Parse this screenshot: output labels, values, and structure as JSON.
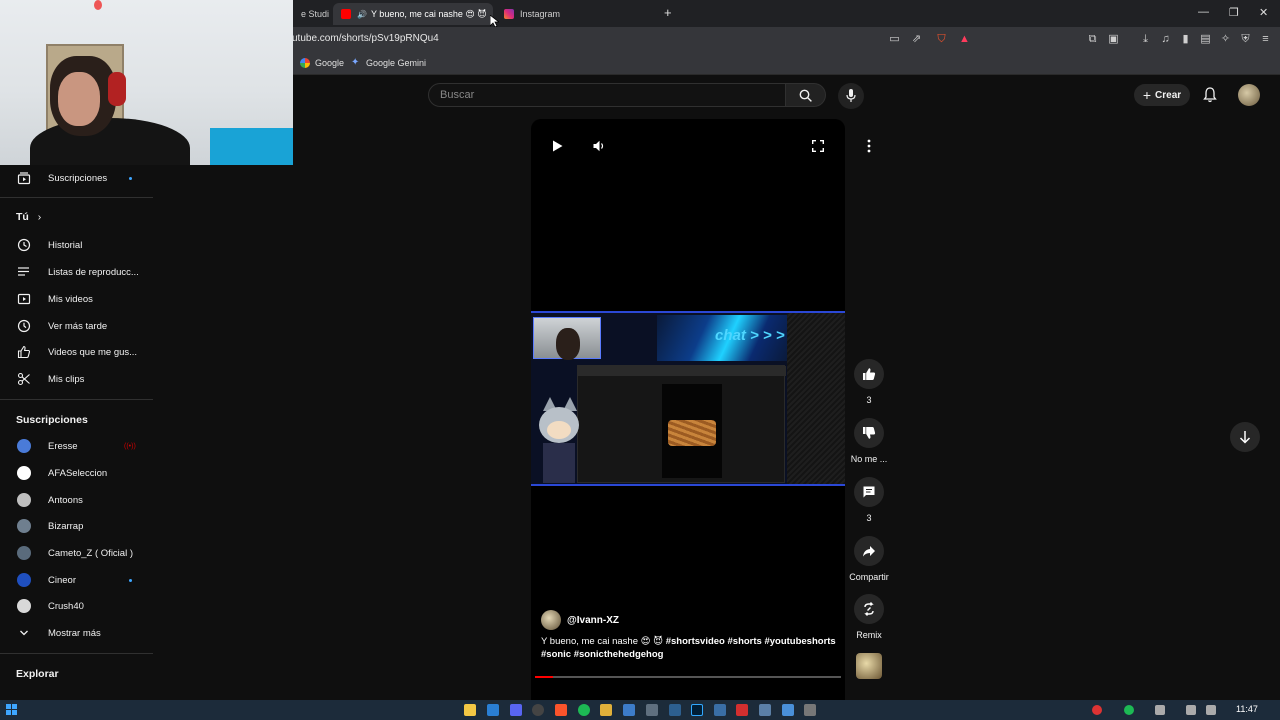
{
  "browser": {
    "tabs": [
      {
        "label": "e Studi"
      },
      {
        "label": "Y bueno, me cai nashe 😍 😈",
        "active": true
      },
      {
        "label": "Instagram"
      }
    ],
    "url": "utube.com/shorts/pSv19pRNQu4",
    "bookmarks": [
      {
        "label": "Google"
      },
      {
        "label": "Google Gemini"
      }
    ]
  },
  "header": {
    "search_placeholder": "Buscar",
    "create_label": "Crear"
  },
  "sidebar": {
    "top_items": [
      {
        "label": "Suscripciones",
        "icon": "subscriptions-icon"
      }
    ],
    "you_title": "Tú",
    "you_items": [
      {
        "label": "Historial",
        "icon": "history-icon"
      },
      {
        "label": "Listas de reproducc...",
        "icon": "playlists-icon"
      },
      {
        "label": "Mis videos",
        "icon": "my-videos-icon"
      },
      {
        "label": "Ver más tarde",
        "icon": "watch-later-icon"
      },
      {
        "label": "Videos que me gus...",
        "icon": "liked-icon"
      },
      {
        "label": "Mis clips",
        "icon": "clips-icon"
      }
    ],
    "subs_title": "Suscripciones",
    "subscriptions": [
      {
        "label": "Eresse",
        "badge": "live",
        "color": "#4a7bd8"
      },
      {
        "label": "AFASeleccion",
        "color": "#ffffff"
      },
      {
        "label": "Antoons",
        "color": "#bfbfbf"
      },
      {
        "label": "Bizarrap",
        "color": "#6f7f8f"
      },
      {
        "label": "Cameto_Z ( Oficial )",
        "color": "#5a6b7c"
      },
      {
        "label": "Cineor",
        "badge": "dot",
        "color": "#1f4fbf"
      },
      {
        "label": "Crush40",
        "color": "#d8d8d8"
      }
    ],
    "show_more": "Mostrar más",
    "explore_title": "Explorar"
  },
  "short": {
    "channel": "@Ivann-XZ",
    "title": "Y bueno, me cai nashe 😍 😈 ",
    "hashtags": "#shortsvideo #shorts #youtubeshorts #sonic #sonicthehedgehog",
    "stream_overlay_text": "chat > > >",
    "progress": 0.06
  },
  "actions": {
    "likes": "3",
    "dislike_label": "No me ...",
    "comments": "3",
    "share_label": "Compartir",
    "remix_label": "Remix"
  },
  "taskbar": {
    "time": "11:47"
  },
  "colors": {
    "background": "#0f0f0f",
    "accent_red": "#ff0000",
    "link_blue": "#3ea6ff"
  }
}
